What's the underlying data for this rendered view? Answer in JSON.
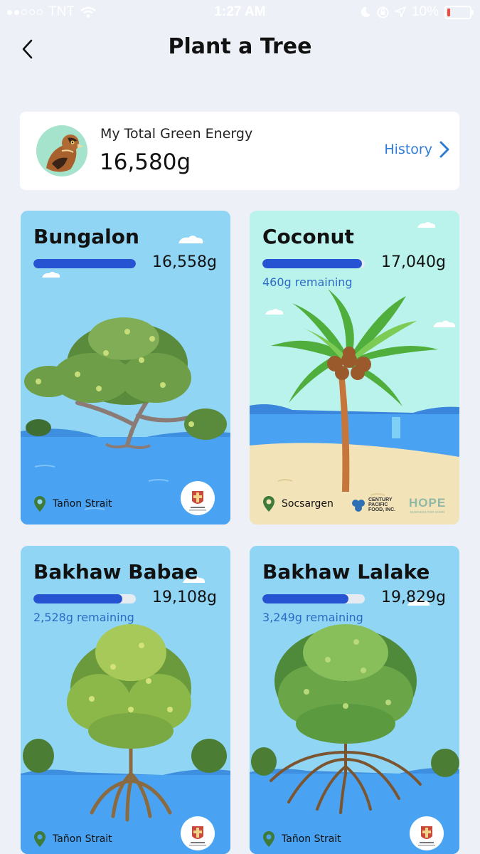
{
  "status_bar": {
    "carrier": "TNT",
    "time": "1:27 AM",
    "battery": "10%"
  },
  "header": {
    "title": "Plant a Tree"
  },
  "energy": {
    "label": "My Total Green Energy",
    "value": "16,580g",
    "history_label": "History"
  },
  "trees": [
    {
      "name": "Bungalon",
      "target": "16,558g",
      "progress": 1.0,
      "remaining": "",
      "location": "Tañon Strait",
      "partners": [
        "RAFI"
      ]
    },
    {
      "name": "Coconut",
      "target": "17,040g",
      "progress": 0.97,
      "remaining": "460g remaining",
      "location": "Socsargen",
      "partners": [
        "CENTURY PACIFIC FOOD, INC.",
        "HOPE"
      ]
    },
    {
      "name": "Bakhaw Babae",
      "target": "19,108g",
      "progress": 0.87,
      "remaining": "2,528g remaining",
      "location": "Tañon Strait",
      "partners": [
        "RAFI"
      ]
    },
    {
      "name": "Bakhaw Lalake",
      "target": "19,829g",
      "progress": 0.84,
      "remaining": "3,249g remaining",
      "location": "Tañon Strait",
      "partners": [
        "RAFI"
      ]
    }
  ],
  "logos": {
    "century_line1": "CENTURY",
    "century_line2": "PACIFIC",
    "century_line3": "FOOD, INC.",
    "hope": "HOPE",
    "hope_sub": "BUSINESS FOR GOOD",
    "rafi": "RAFI"
  },
  "colors": {
    "background": "#edf0f7",
    "progress_fill": "#2553d2",
    "link_blue": "#2e7bd6",
    "sky_blue": "#90d6f4",
    "sky_mint": "#baf3ec",
    "water": "#4aa3f2",
    "sand": "#f2e3b8",
    "pin_green": "#3e7a3a"
  },
  "icons": [
    "signal-icon",
    "wifi-icon",
    "moon-icon",
    "lock-rotation-icon",
    "location-arrow-icon",
    "battery-icon",
    "back-chevron-icon",
    "chevron-right-icon",
    "location-pin-icon"
  ]
}
